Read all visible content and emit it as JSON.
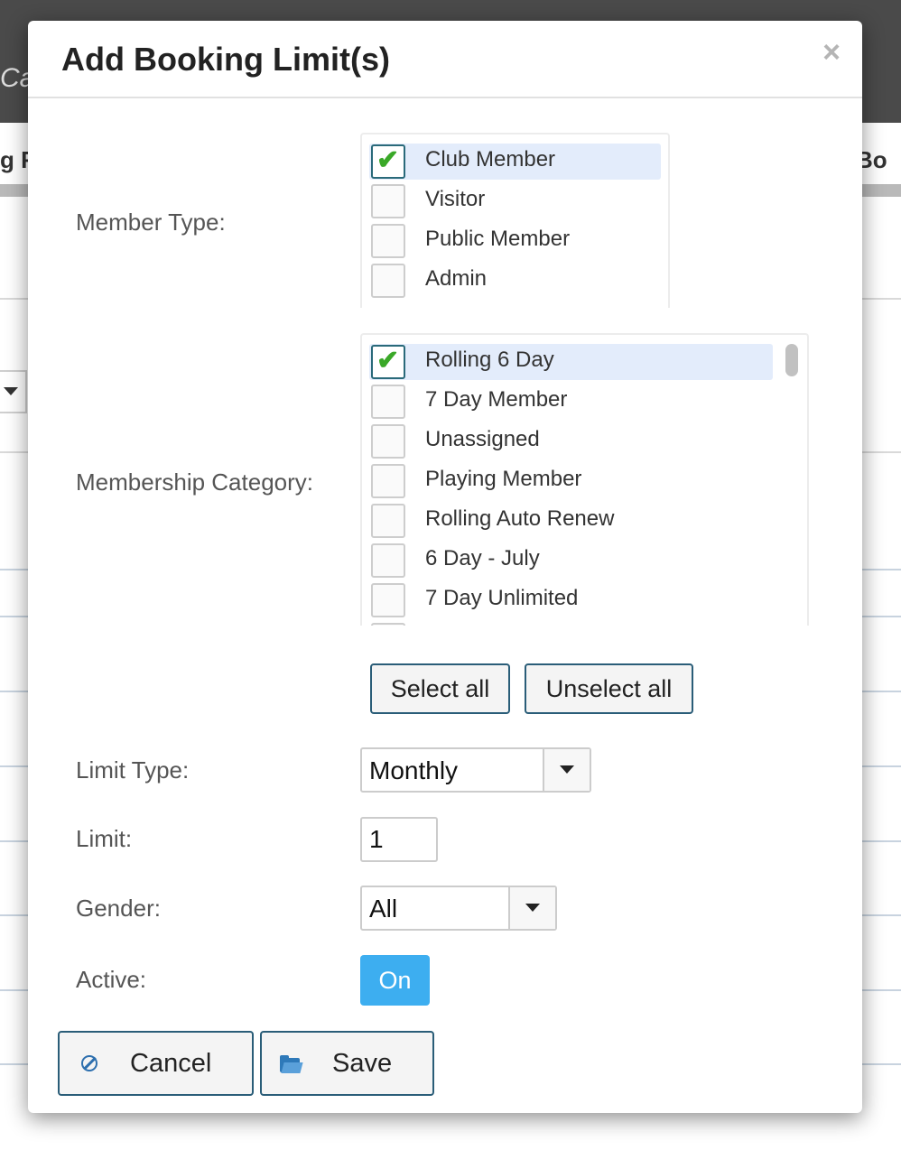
{
  "background": {
    "header_text": "Ca",
    "tab_left": "g R",
    "tab_right": "Bo"
  },
  "modal": {
    "title": "Add Booking Limit(s)",
    "close_symbol": "×"
  },
  "member_type": {
    "label": "Member Type:",
    "items": [
      {
        "label": "Club Member",
        "checked": true
      },
      {
        "label": "Visitor",
        "checked": false
      },
      {
        "label": "Public Member",
        "checked": false
      },
      {
        "label": "Admin",
        "checked": false
      }
    ]
  },
  "membership_category": {
    "label": "Membership Category:",
    "items": [
      {
        "label": "Rolling 6 Day",
        "checked": true
      },
      {
        "label": "7 Day Member",
        "checked": false
      },
      {
        "label": "Unassigned",
        "checked": false
      },
      {
        "label": "Playing Member",
        "checked": false
      },
      {
        "label": "Rolling Auto Renew",
        "checked": false
      },
      {
        "label": "6 Day - July",
        "checked": false
      },
      {
        "label": "7 Day Unlimited",
        "checked": false
      }
    ],
    "select_all_label": "Select all",
    "unselect_all_label": "Unselect all"
  },
  "limit_type": {
    "label": "Limit Type:",
    "value": "Monthly"
  },
  "limit": {
    "label": "Limit:",
    "value": "1"
  },
  "gender": {
    "label": "Gender:",
    "value": "All"
  },
  "active": {
    "label": "Active:",
    "toggle_label": "On"
  },
  "footer": {
    "cancel_label": "Cancel",
    "save_label": "Save"
  },
  "check_glyph": "✔",
  "icons": {
    "cancel": "ban-icon",
    "save": "folder-open-icon",
    "close": "close-icon",
    "dropdown": "chevron-down-icon",
    "checkmark": "checkmark-icon"
  }
}
